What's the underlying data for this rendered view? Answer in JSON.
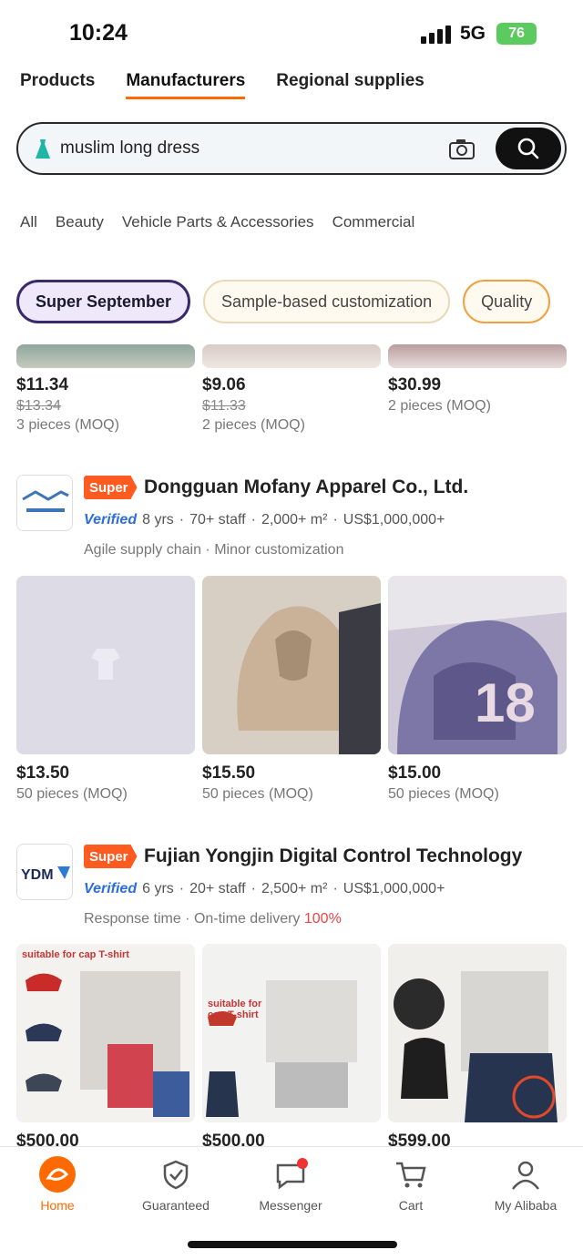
{
  "status": {
    "time": "10:24",
    "network": "5G",
    "battery": "76"
  },
  "tabs": [
    {
      "label": "Products"
    },
    {
      "label": "Manufacturers"
    },
    {
      "label": "Regional supplies"
    }
  ],
  "search": {
    "value": "muslim long dress"
  },
  "categories": [
    {
      "label": "All"
    },
    {
      "label": "Beauty"
    },
    {
      "label": "Vehicle Parts & Accessories"
    },
    {
      "label": "Commercial"
    }
  ],
  "chips": [
    {
      "label": "Super September"
    },
    {
      "label": "Sample-based customization"
    },
    {
      "label": "Quality"
    }
  ],
  "partial_row": [
    {
      "price": "$11.34",
      "old_price": "$13.34",
      "moq": "3 pieces (MOQ)"
    },
    {
      "price": "$9.06",
      "old_price": "$11.33",
      "moq": "2 pieces (MOQ)"
    },
    {
      "price": "$30.99",
      "old_price": "",
      "moq": "2 pieces (MOQ)"
    }
  ],
  "suppliers": [
    {
      "tag": "Super",
      "name": "Dongguan Mofany Apparel Co., Ltd.",
      "verified": "Verified",
      "years": "8 yrs",
      "staff": "70+ staff",
      "area": "2,000+ m²",
      "revenue": "US$1,000,000+",
      "tagline_1": "Agile supply chain",
      "tagline_2": "Minor customization",
      "products": [
        {
          "price": "$13.50",
          "moq": "50 pieces (MOQ)"
        },
        {
          "price": "$15.50",
          "moq": "50 pieces (MOQ)"
        },
        {
          "price": "$15.00",
          "moq": "50 pieces (MOQ)"
        }
      ]
    },
    {
      "tag": "Super",
      "name": "Fujian Yongjin Digital Control Technology",
      "verified": "Verified",
      "years": "6 yrs",
      "staff": "20+ staff",
      "area": "2,500+ m²",
      "revenue": "US$1,000,000+",
      "tagline_1": "Response time",
      "tagline_2": "On-time delivery",
      "tagline_3": "100%",
      "products": [
        {
          "price": "$500.00",
          "moq": "",
          "label": "suitable for cap T-shirt"
        },
        {
          "price": "$500.00",
          "moq": "",
          "label": "suitable for cap T-shirt"
        },
        {
          "price": "$599.00",
          "moq": "",
          "label": ""
        }
      ]
    }
  ],
  "nav": [
    {
      "label": "Home"
    },
    {
      "label": "Guaranteed"
    },
    {
      "label": "Messenger"
    },
    {
      "label": "Cart"
    },
    {
      "label": "My Alibaba"
    }
  ],
  "colors": {
    "accent": "#ff6a00",
    "verified": "#2d6cdf",
    "chip_active": "#efe8fb"
  }
}
